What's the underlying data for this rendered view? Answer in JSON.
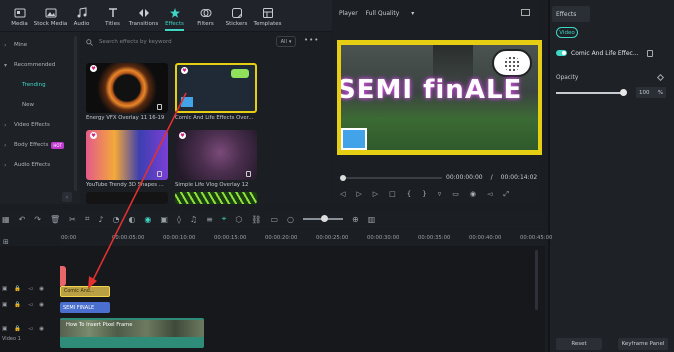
{
  "toolbar": {
    "items": [
      {
        "label": "Media",
        "icon": "media-icon"
      },
      {
        "label": "Stock Media",
        "icon": "stock-media-icon"
      },
      {
        "label": "Audio",
        "icon": "audio-icon"
      },
      {
        "label": "Titles",
        "icon": "titles-icon"
      },
      {
        "label": "Transitions",
        "icon": "transitions-icon"
      },
      {
        "label": "Effects",
        "icon": "effects-icon",
        "active": true
      },
      {
        "label": "Filters",
        "icon": "filters-icon"
      },
      {
        "label": "Stickers",
        "icon": "stickers-icon"
      },
      {
        "label": "Templates",
        "icon": "templates-icon"
      }
    ]
  },
  "sidebar": {
    "items": [
      {
        "label": "Mine"
      },
      {
        "label": "Recommended"
      },
      {
        "label": "Trending"
      },
      {
        "label": "New"
      },
      {
        "label": "Video Effects"
      },
      {
        "label": "Body Effects",
        "badge": "HOT"
      },
      {
        "label": "Audio Effects"
      }
    ]
  },
  "effects_panel": {
    "search_placeholder": "Search effects by keyword",
    "filter_label": "All",
    "cards": [
      {
        "label": "Energy VFX Overlay 11 16-19"
      },
      {
        "label": "Comic And Life Effects Over..."
      },
      {
        "label": "YouTube Trendy 3D Shapes ..."
      },
      {
        "label": "Simple Life Vlog Overlay 12"
      }
    ]
  },
  "preview": {
    "player_label": "Player",
    "quality": "Full Quality",
    "overlay_text": "SEMI finALE",
    "current_time": "00:00:00:00",
    "total_time": "00:00:14:02"
  },
  "properties": {
    "tab": "Effects",
    "video_chip": "Video",
    "effect_name": "Comic And Life Effec...",
    "opacity_label": "Opacity",
    "opacity_value": "100",
    "opacity_unit": "%",
    "reset_label": "Reset",
    "keyframe_label": "Keyframe Panel"
  },
  "timeline": {
    "ruler": [
      "00:00",
      "00:00:05:00",
      "00:00:10:00",
      "00:00:15:00",
      "00:00:20:00",
      "00:00:25:00",
      "00:00:30:00",
      "00:00:35:00",
      "00:00:40:00",
      "00:00:45:00"
    ],
    "clip_effect": "Comic And...",
    "clip_title": "SEMI FINALE",
    "clip_video": "How To Insert Pixel Frame",
    "video_track_label": "Video 1",
    "track_numbers": [
      "3",
      "2",
      "1"
    ]
  },
  "colors": {
    "accent": "#3fd6c4",
    "frame_yellow": "#e6cf12",
    "playhead": "#e8656a",
    "annotation_arrow": "#e03030"
  }
}
